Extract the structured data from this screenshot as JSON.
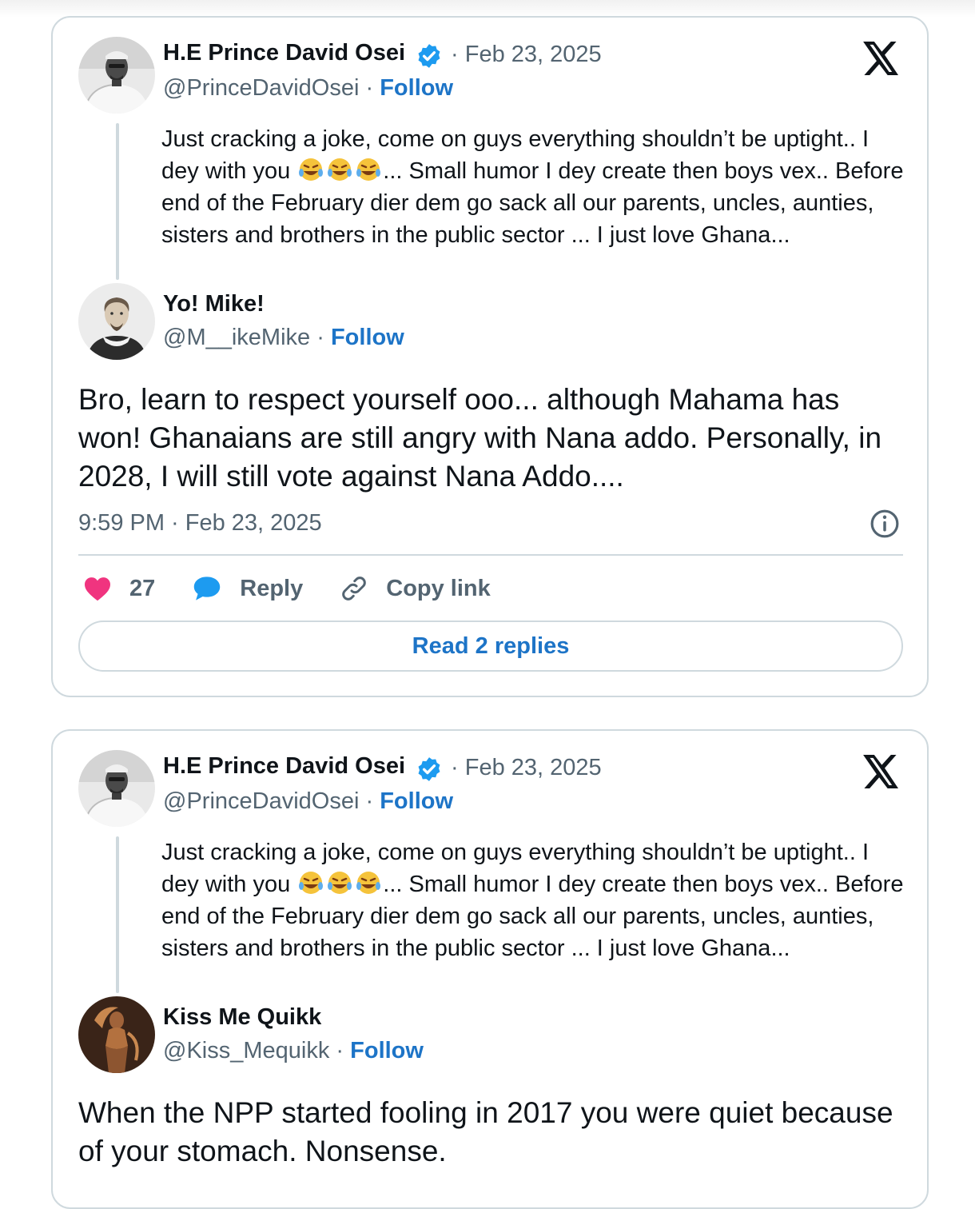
{
  "tweets": [
    {
      "parent": {
        "name": "H.E Prince David Osei",
        "date": "Feb 23, 2025",
        "handle": "@PrinceDavidOsei",
        "follow": "Follow",
        "text_1": "Just cracking a joke,  come on guys everything shouldn’t be uptight.. I dey with you ",
        "emojis": "🤣🤣🤣",
        "text_2": "... Small humor I dey create then boys vex.. Before  end of the February dier dem go sack all our parents, uncles, aunties, sisters and brothers in the public sector ... I just love Ghana..."
      },
      "reply": {
        "name": "Yo! Mike!",
        "handle": "@M__ikeMike",
        "follow": "Follow",
        "text": "Bro, learn to respect yourself ooo... although Mahama has won! Ghanaians are still angry with Nana addo. Personally, in 2028, I will still vote against Nana Addo....",
        "timestamp": "9:59 PM · Feb 23, 2025"
      },
      "likes": "27",
      "reply_label": "Reply",
      "copy_label": "Copy link",
      "read_replies": "Read 2 replies"
    },
    {
      "parent": {
        "name": "H.E Prince David Osei",
        "date": "Feb 23, 2025",
        "handle": "@PrinceDavidOsei",
        "follow": "Follow",
        "text_1": "Just cracking a joke,  come on guys everything shouldn’t be uptight.. I dey with you ",
        "emojis": "🤣🤣🤣",
        "text_2": "... Small humor I dey create then boys vex.. Before  end of the February dier dem go sack all our parents, uncles, aunties, sisters and brothers in the public sector ... I just love Ghana..."
      },
      "reply": {
        "name": "Kiss Me Quikk",
        "handle": "@Kiss_Mequikk",
        "follow": "Follow",
        "text": "When the NPP started fooling in 2017 you were quiet because of your stomach. Nonsense."
      }
    }
  ],
  "separator": "·",
  "colors": {
    "follow_blue": "#1d74c7",
    "verified_blue": "#1d9bf0",
    "like_pink": "#f91880",
    "muted": "#536471",
    "border": "#cfd9de"
  },
  "icons": [
    "x-logo-icon",
    "verified-badge-icon",
    "heart-icon",
    "reply-bubble-icon",
    "link-icon",
    "info-icon",
    "laughing-emoji-icon"
  ]
}
